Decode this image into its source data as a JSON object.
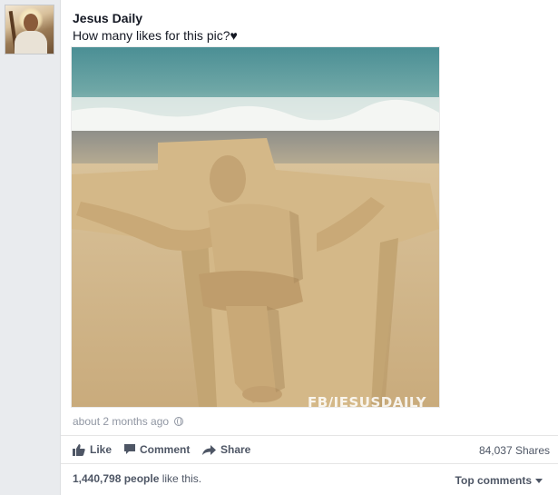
{
  "post": {
    "page_name": "Jesus Daily",
    "text": "How many likes for this pic?♥",
    "timestamp": "about 2 months ago",
    "photo_watermark": "FB/JESUSDAILY"
  },
  "actions": {
    "like_label": "Like",
    "comment_label": "Comment",
    "share_label": "Share",
    "shares_count": "84,037 Shares"
  },
  "likes": {
    "count": "1,440,798 people",
    "suffix": " like this.",
    "top_comments_label": "Top comments"
  },
  "icons": {
    "like": "thumbs-up-icon",
    "comment": "comment-bubble-icon",
    "share": "share-arrow-icon",
    "privacy": "globe-icon",
    "sort": "caret-down-icon"
  },
  "colors": {
    "text_dark": "#141823",
    "text_muted": "#9197a3",
    "action_text": "#4e5665",
    "background": "#e9ebee"
  }
}
